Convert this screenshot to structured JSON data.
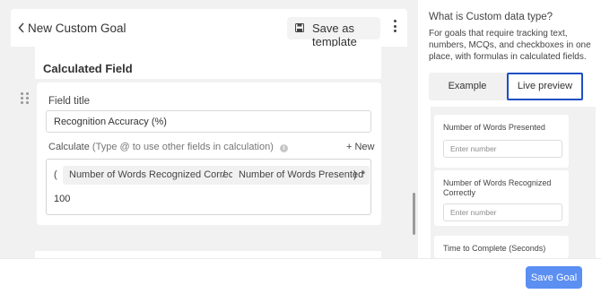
{
  "header": {
    "title": "New Custom Goal",
    "save_template_label": "Save as template"
  },
  "section": {
    "title": "Calculated Field"
  },
  "field": {
    "title_label": "Field title",
    "title_value": "Recognition Accuracy (%)",
    "calc_label": "Calculate",
    "calc_hint": "(Type @ to use other fields in calculation)",
    "new_label": "+ New",
    "formula": {
      "open_paren": "(",
      "token_1": "Number of Words Recognized Correctly",
      "divide": "/",
      "token_2": "Number of Words Presented",
      "close_paren": ")",
      "multiply": "*",
      "constant": "100"
    }
  },
  "help": {
    "question": "What is Custom data type?",
    "description": "For goals that require tracking text, numbers, MCQs, and checkboxes in one place, with formulas in calculated fields."
  },
  "tabs": [
    {
      "label": "Example",
      "active": false
    },
    {
      "label": "Live preview",
      "active": true
    }
  ],
  "preview": {
    "fields": [
      {
        "label": "Number of Words Presented",
        "placeholder": "Enter number"
      },
      {
        "label": "Number of Words Recognized Correctly",
        "placeholder": "Enter number"
      },
      {
        "label": "Time to Complete (Seconds)"
      }
    ]
  },
  "footer": {
    "save_goal_label": "Save Goal"
  },
  "colors": {
    "accent": "#5b8ff2",
    "active_tab_border": "#1f4fc4",
    "pane_background": "#f1f1f1"
  },
  "icons": [
    "chevron-left-icon",
    "save-icon",
    "kebab-menu-icon",
    "drag-handle-icon",
    "info-icon"
  ]
}
